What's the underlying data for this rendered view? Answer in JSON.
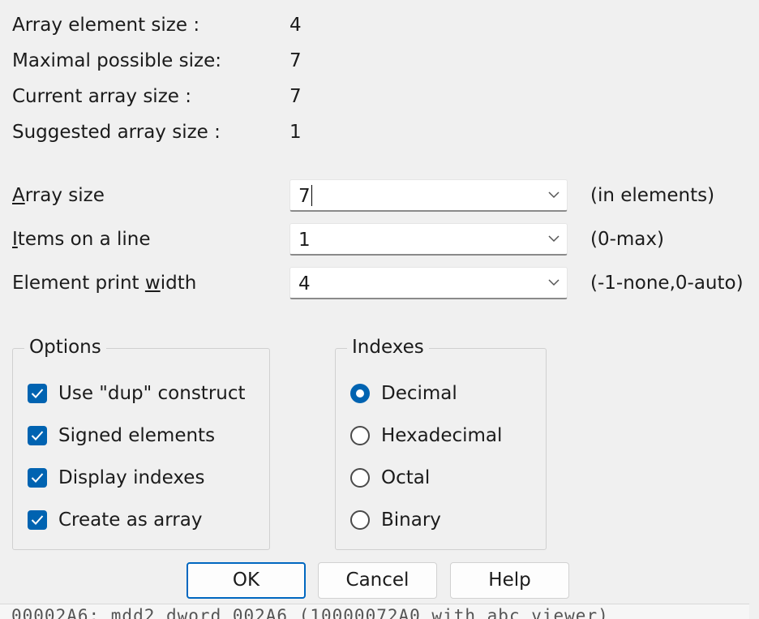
{
  "info": {
    "element_size": {
      "label": "Array element size   :",
      "value": "4"
    },
    "max_size": {
      "label": "Maximal possible size:",
      "value": "7"
    },
    "current_size": {
      "label": "Current array size    :",
      "value": "7"
    },
    "suggested_size": {
      "label": "Suggested array size :",
      "value": "1"
    }
  },
  "fields": {
    "array_size": {
      "label_prefix": "",
      "label_accel": "A",
      "label_rest": "rray size",
      "value": "7",
      "hint": "(in elements)"
    },
    "items_per_line": {
      "label_prefix": "",
      "label_accel": "I",
      "label_rest": "tems on a line",
      "value": "1",
      "hint": "(0-max)"
    },
    "print_width": {
      "label_prefix": "Element print ",
      "label_accel": "w",
      "label_rest": "idth",
      "value": "4",
      "hint": "(-1-none,0-auto)"
    }
  },
  "options": {
    "title": "Options",
    "items": [
      {
        "label": "Use \"dup\" construct",
        "checked": true
      },
      {
        "label": "Signed elements",
        "checked": true
      },
      {
        "label": "Display indexes",
        "checked": true
      },
      {
        "label": "Create as array",
        "checked": true
      }
    ]
  },
  "indexes": {
    "title": "Indexes",
    "items": [
      {
        "label": "Decimal",
        "selected": true
      },
      {
        "label": "Hexadecimal",
        "selected": false
      },
      {
        "label": "Octal",
        "selected": false
      },
      {
        "label": "Binary",
        "selected": false
      }
    ]
  },
  "buttons": {
    "ok": "OK",
    "cancel": "Cancel",
    "help": "Help"
  },
  "background_text": "00002A6:    mdd2 dword 002A6 (10000072A0 with abc viewer)",
  "colors": {
    "accent": "#0063b1",
    "default_button_border": "#0067c0",
    "background": "#f0f0f0"
  }
}
